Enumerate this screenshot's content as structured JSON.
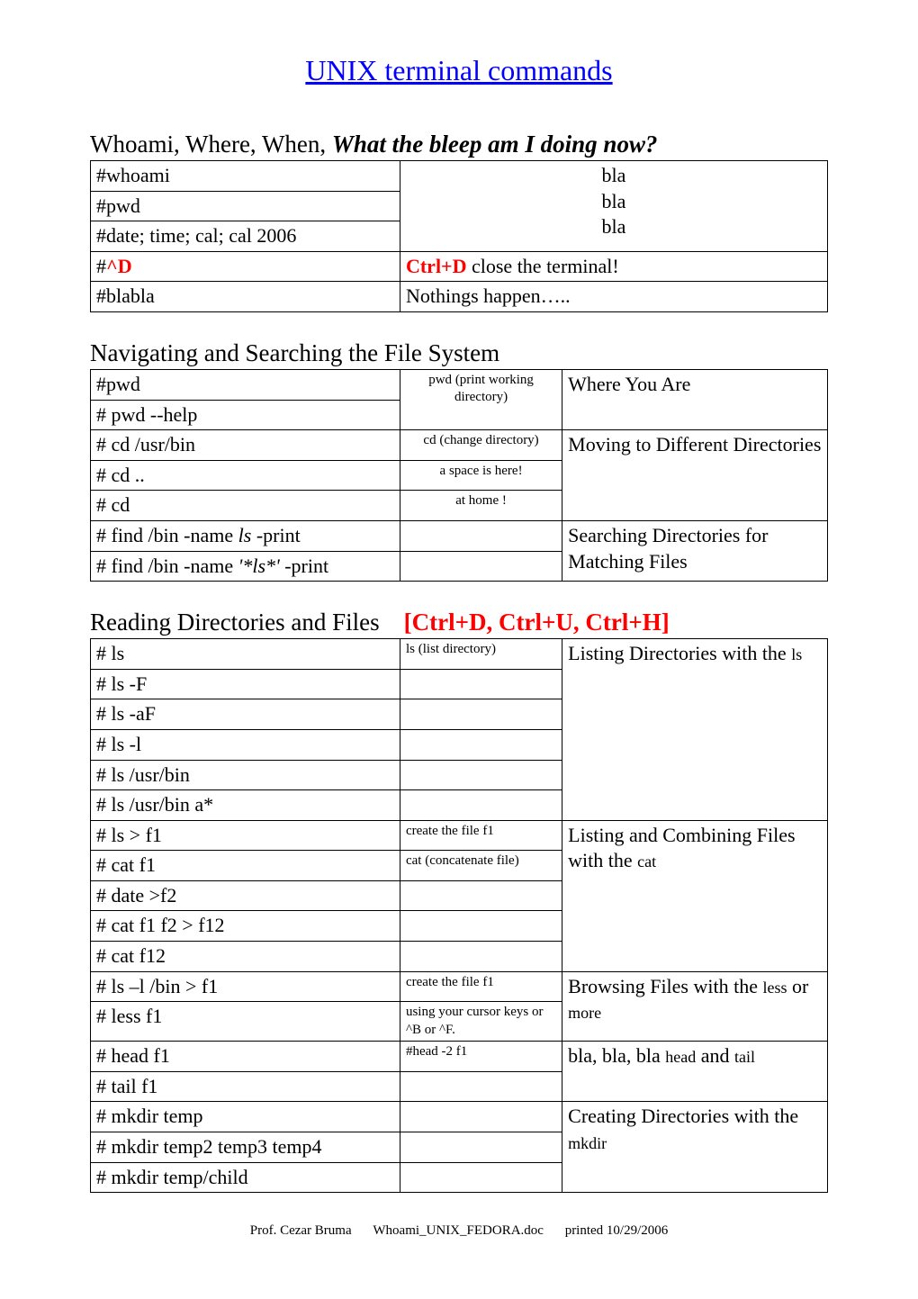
{
  "title": "UNIX terminal commands",
  "section1": {
    "heading_plain": "Whoami, Where, When, ",
    "heading_em": "What the bleep am I doing now?",
    "rows": {
      "whoami": "#whoami",
      "pwd": "#pwd",
      "date": "#date; time; cal; cal 2006",
      "bla1": "bla",
      "bla2": "bla",
      "bla3": "bla",
      "ctrld_cmd_hash": "#",
      "ctrld_cmd_key": "^D",
      "ctrld_desc_key": "Ctrl+D",
      "ctrld_desc_rest": " close the terminal!",
      "blabla": "#blabla",
      "nothings": "Nothings happen….."
    }
  },
  "section2": {
    "heading": "Navigating and Searching the File System",
    "rows": {
      "pwd": "#pwd",
      "pwd_note_mono": "pwd",
      "pwd_note_rest": " (print working directory)",
      "pwdhelp": "# pwd --help",
      "where": "Where You Are",
      "cdusr": "# cd /usr/bin",
      "cd_note_mono": "cd",
      "cd_note_rest": " (change directory)",
      "cddots": "# cd ..",
      "space": "a space is here!",
      "cd": "# cd",
      "athome": "at home !",
      "moving": "Moving to Different Directories",
      "find1_a": "# find /bin -name ",
      "find1_b": "ls",
      "find1_c": " -print",
      "find2_a": "# find /bin -name ",
      "find2_b": "'*ls*'",
      "find2_c": " -print",
      "searching": "Searching Directories for Matching Files"
    }
  },
  "section3": {
    "heading_plain": "Reading Directories and Files",
    "heading_extra": "[Ctrl+D, Ctrl+U, Ctrl+H]",
    "rows": {
      "ls": "# ls",
      "ls_note_mono": "ls",
      "ls_note_rest": " (list directory)",
      "lsF": "# ls -F",
      "lsaF": "# ls -aF",
      "lsl": "# ls -l",
      "lsusr": "# ls /usr/bin",
      "lsusra": "# ls /usr/bin  a*",
      "listing_a": "Listing Directories with the ",
      "listing_b": "ls",
      "lsf1": "# ls > f1",
      "createf1": "create the file f1",
      "catf1": "# cat f1",
      "cat_note_mono": "cat",
      "cat_note_rest": " (concatenate file)",
      "datef2": "# date >f2",
      "catf1f2": "# cat f1 f2 > f12",
      "catf12": "# cat f12",
      "combine_a": "Listing and Combining Files with the ",
      "combine_b": "cat",
      "lslbin": "# ls –l /bin > f1",
      "createf1b": "create the file f1",
      "lessf1": "# less f1",
      "cursornote": "using your cursor keys or  ^B or ^F.",
      "browse_a": "Browsing Files with the ",
      "browse_less": "less",
      "browse_or": "  or ",
      "browse_more": "more",
      "headf1": "# head f1",
      "headnote": "#head -2 f1",
      "tailf1": "# tail f1",
      "headtail_a": "bla, bla, bla ",
      "headtail_b": "head",
      "headtail_c": " and ",
      "headtail_d": "tail",
      "mkdir1": "# mkdir temp",
      "mkdir2": "# mkdir temp2 temp3 temp4",
      "mkdir3": "# mkdir temp/child",
      "mkdesc_a": "Creating Directories with the ",
      "mkdesc_b": "mkdir"
    }
  },
  "footer": {
    "author": "Prof. Cezar Bruma",
    "file": "Whoami_UNIX_FEDORA.doc",
    "printed": "printed  10/29/2006"
  }
}
